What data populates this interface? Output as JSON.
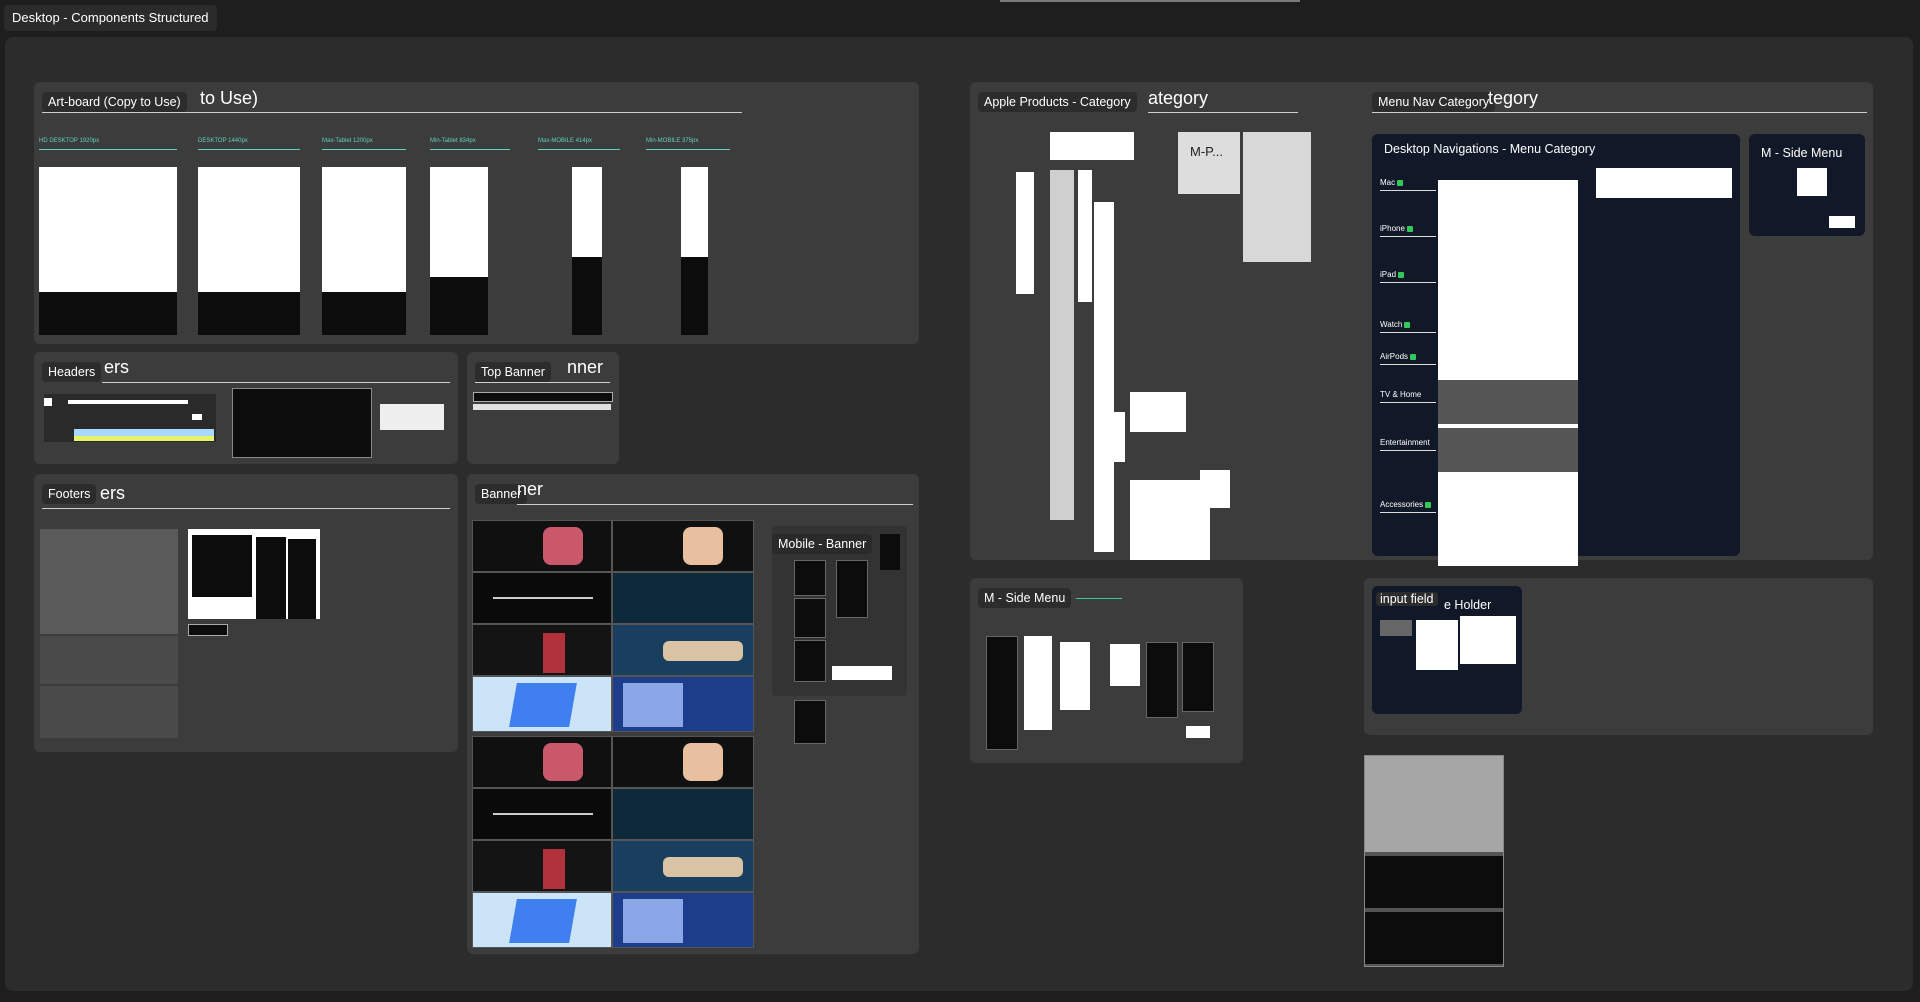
{
  "page_tab": "Desktop - Components Structured",
  "sections": {
    "artboard": {
      "label": "Art-board (Copy to Use)",
      "ghost": "to Use)",
      "frames": [
        "HD DESKTOP 1920px",
        "DESKTOP 1440px",
        "Max-Tablet 1200px",
        "Min-Tablet 834px",
        "Max-MOBILE 414px",
        "Min-MOBILE 375px"
      ]
    },
    "headers": {
      "label": "Headers",
      "ghost": "ers"
    },
    "top_banner": {
      "label": "Top Banner",
      "ghost": "nner"
    },
    "footers": {
      "label": "Footers",
      "ghost": "ers"
    },
    "banner": {
      "label": "Banner",
      "ghost": "ner",
      "mobile_label": "Mobile - Banner"
    },
    "apple_products": {
      "label": "Apple Products - Category",
      "ghost": "ategory",
      "mp_label": "M-P..."
    },
    "menu_nav": {
      "label": "Menu Nav Category",
      "ghost": "tegory",
      "desktop_label": "Desktop Navigations - Menu Category",
      "side_label": "M - Side Menu",
      "categories": [
        "Mac",
        "iPhone",
        "iPad",
        "Watch",
        "AirPods",
        "TV & Home",
        "Entertainment",
        "Accessories"
      ]
    },
    "m_side_menu": {
      "label": "M - Side Menu"
    },
    "input_field": {
      "label": "input field",
      "ghost": "e Holder"
    }
  },
  "colors": {
    "canvas": "#2c2c2c",
    "section": "#3c3c3c",
    "accent": "#5fd3b8",
    "navy": "#111827"
  }
}
